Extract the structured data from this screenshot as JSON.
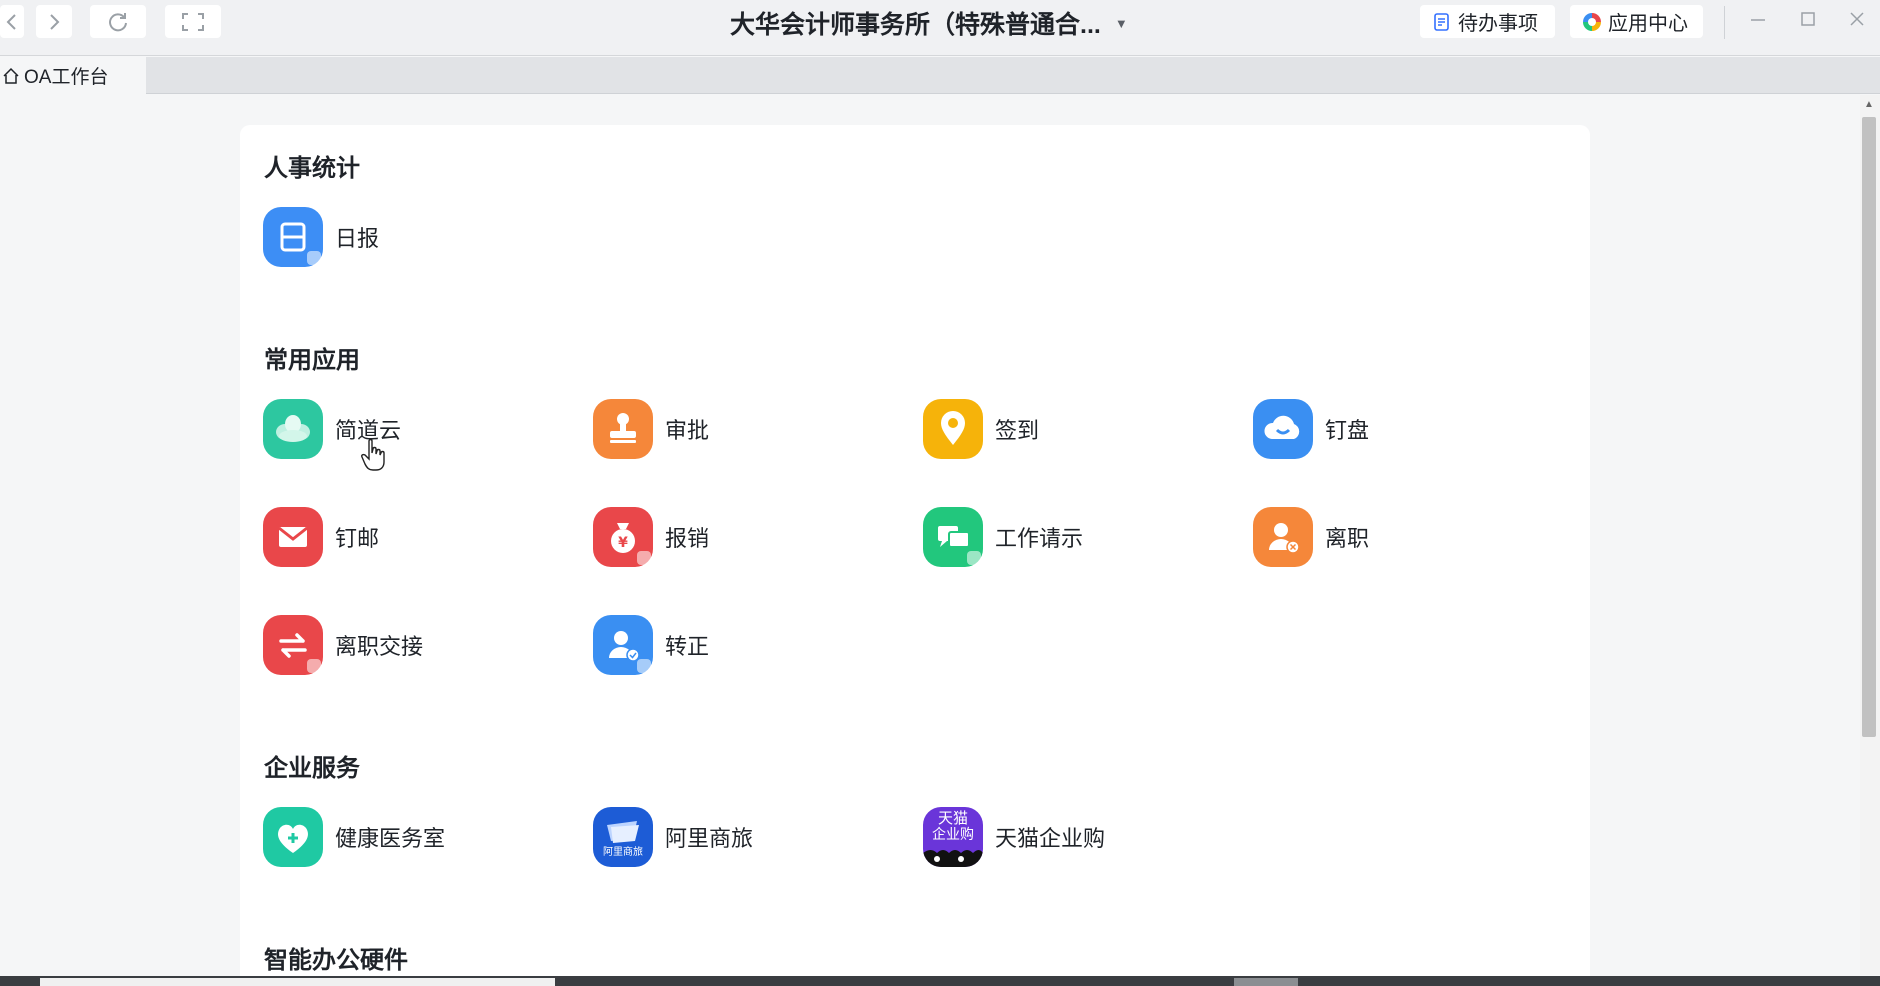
{
  "window": {
    "title": "大华会计师事务所（特殊普通合...",
    "todo_label": "待办事项",
    "app_center_label": "应用中心"
  },
  "tabs": [
    {
      "label": "OA工作台"
    }
  ],
  "sections": [
    {
      "title": "人事统计",
      "apps": [
        {
          "label": "日报",
          "color": "#3d8ef5",
          "icon": "daily-report-icon"
        }
      ]
    },
    {
      "title": "常用应用",
      "apps": [
        {
          "label": "简道云",
          "color": "#2dc7a0",
          "icon": "cloud-petals-icon"
        },
        {
          "label": "审批",
          "color": "#f5873a",
          "icon": "stamp-icon"
        },
        {
          "label": "签到",
          "color": "#f6b30a",
          "icon": "location-pin-icon"
        },
        {
          "label": "钉盘",
          "color": "#3a8ff2",
          "icon": "cloud-drive-icon"
        },
        {
          "label": "钉邮",
          "color": "#e9474a",
          "icon": "mail-icon"
        },
        {
          "label": "报销",
          "color": "#e9474a",
          "icon": "money-bag-icon"
        },
        {
          "label": "工作请示",
          "color": "#22c77d",
          "icon": "chat-bubbles-icon"
        },
        {
          "label": "离职",
          "color": "#f5873a",
          "icon": "user-remove-icon"
        },
        {
          "label": "离职交接",
          "color": "#e9474a",
          "icon": "swap-arrows-icon"
        },
        {
          "label": "转正",
          "color": "#3a8ff2",
          "icon": "user-check-icon"
        }
      ]
    },
    {
      "title": "企业服务",
      "apps": [
        {
          "label": "健康医务室",
          "color": "#1fc9a3",
          "icon": "heart-plus-icon"
        },
        {
          "label": "阿里商旅",
          "color": "#1d5cd6",
          "icon": "alitrip-logo-icon",
          "logo_text": "阿里商旅"
        },
        {
          "label": "天猫企业购",
          "color": "#6a35d9",
          "icon": "tmall-logo-icon",
          "logo_text_1": "天猫",
          "logo_text_2": "企业购"
        }
      ]
    },
    {
      "title": "智能办公硬件",
      "apps": []
    }
  ]
}
